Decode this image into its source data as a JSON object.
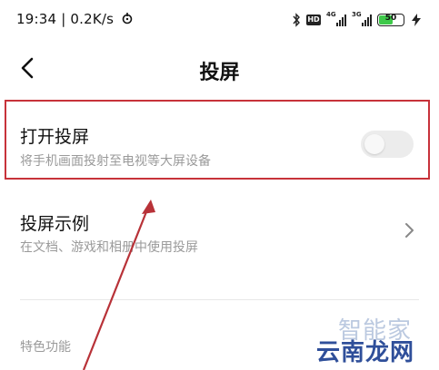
{
  "status_bar": {
    "time_speed": "19:34 | 0.2K/s",
    "hd_label": "HD",
    "sim1_label": "4G",
    "sim2_label": "3G",
    "battery_level": "50",
    "icons": [
      "sync-icon",
      "bluetooth-icon",
      "wifi-signal-icon",
      "cellular-signal-icon",
      "battery-icon",
      "charging-icon"
    ]
  },
  "header": {
    "title": "投屏",
    "back_icon": "back-arrow-icon"
  },
  "settings": {
    "cast": {
      "title": "打开投屏",
      "subtitle": "将手机画面投射至电视等大屏设备",
      "enabled": false
    },
    "example": {
      "title": "投屏示例",
      "subtitle": "在文档、游戏和相册中使用投屏"
    },
    "section_header": "特色功能"
  },
  "watermark": {
    "top": "智能家",
    "bottom": "云南龙网"
  },
  "colors": {
    "highlight": "#c7323a",
    "battery_fill": "#3ec94a",
    "subtitle_text": "#9a9a9a",
    "toggle_off": "#ececec"
  }
}
